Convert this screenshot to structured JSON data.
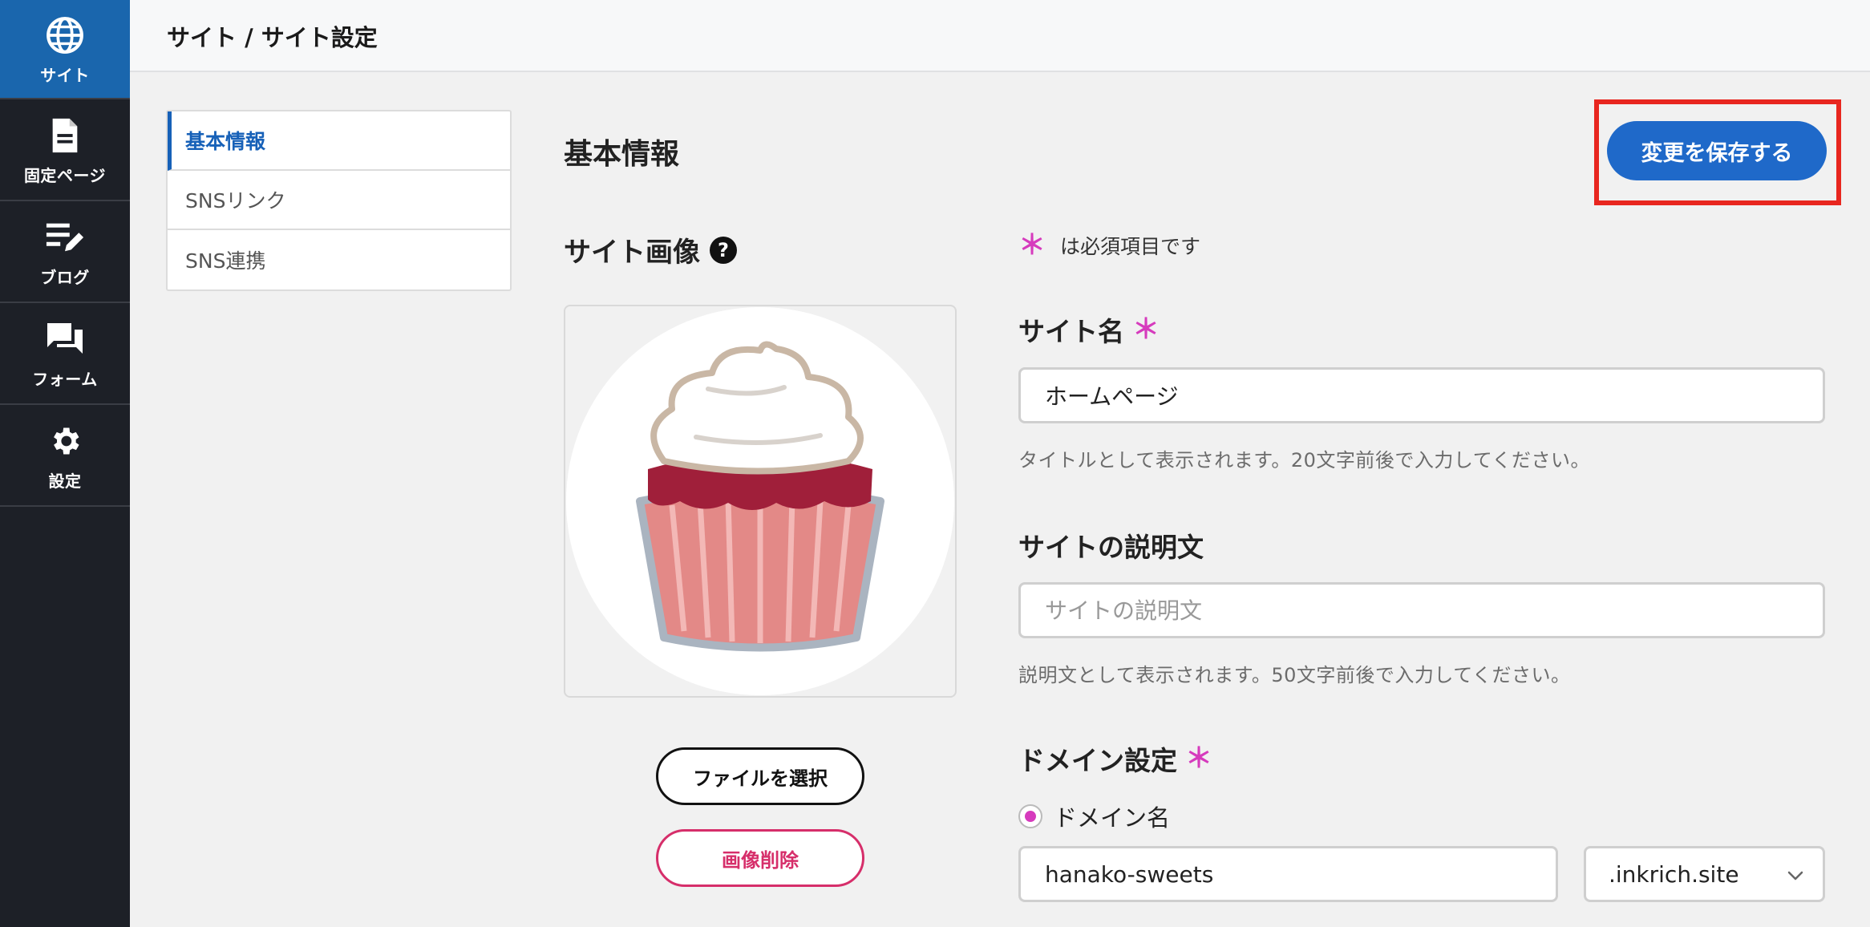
{
  "sidebar": {
    "items": [
      {
        "label": "サイト",
        "icon": "globe-icon",
        "active": true
      },
      {
        "label": "固定ページ",
        "icon": "document-icon"
      },
      {
        "label": "ブログ",
        "icon": "edit-note-icon"
      },
      {
        "label": "フォーム",
        "icon": "chat-icon"
      },
      {
        "label": "設定",
        "icon": "gear-icon"
      }
    ]
  },
  "header": {
    "breadcrumb": "サイト / サイト設定"
  },
  "subnav": {
    "items": [
      {
        "label": "基本情報",
        "active": true
      },
      {
        "label": "SNSリンク"
      },
      {
        "label": "SNS連携"
      }
    ]
  },
  "main": {
    "title": "基本情報",
    "save_label": "変更を保存する",
    "site_image": {
      "title": "サイト画像",
      "help": "?",
      "select_label": "ファイルを選択",
      "delete_label": "画像削除"
    },
    "required_note": "は必須項目です",
    "required_mark": "＊",
    "site_name": {
      "label": "サイト名",
      "value": "ホームページ",
      "hint": "タイトルとして表示されます。20文字前後で入力してください。"
    },
    "site_description": {
      "label": "サイトの説明文",
      "value": "",
      "placeholder": "サイトの説明文",
      "hint": "説明文として表示されます。50文字前後で入力してください。"
    },
    "domain": {
      "label": "ドメイン設定",
      "option_label": "ドメイン名",
      "value": "hanako-sweets",
      "suffix": ".inkrich.site"
    }
  },
  "colors": {
    "sidebar_bg": "#1d2027",
    "active_nav": "#1a66ad",
    "primary": "#1f69c9",
    "required": "#d63bbd",
    "danger": "#d62e6a",
    "highlight": "#e8261f"
  }
}
